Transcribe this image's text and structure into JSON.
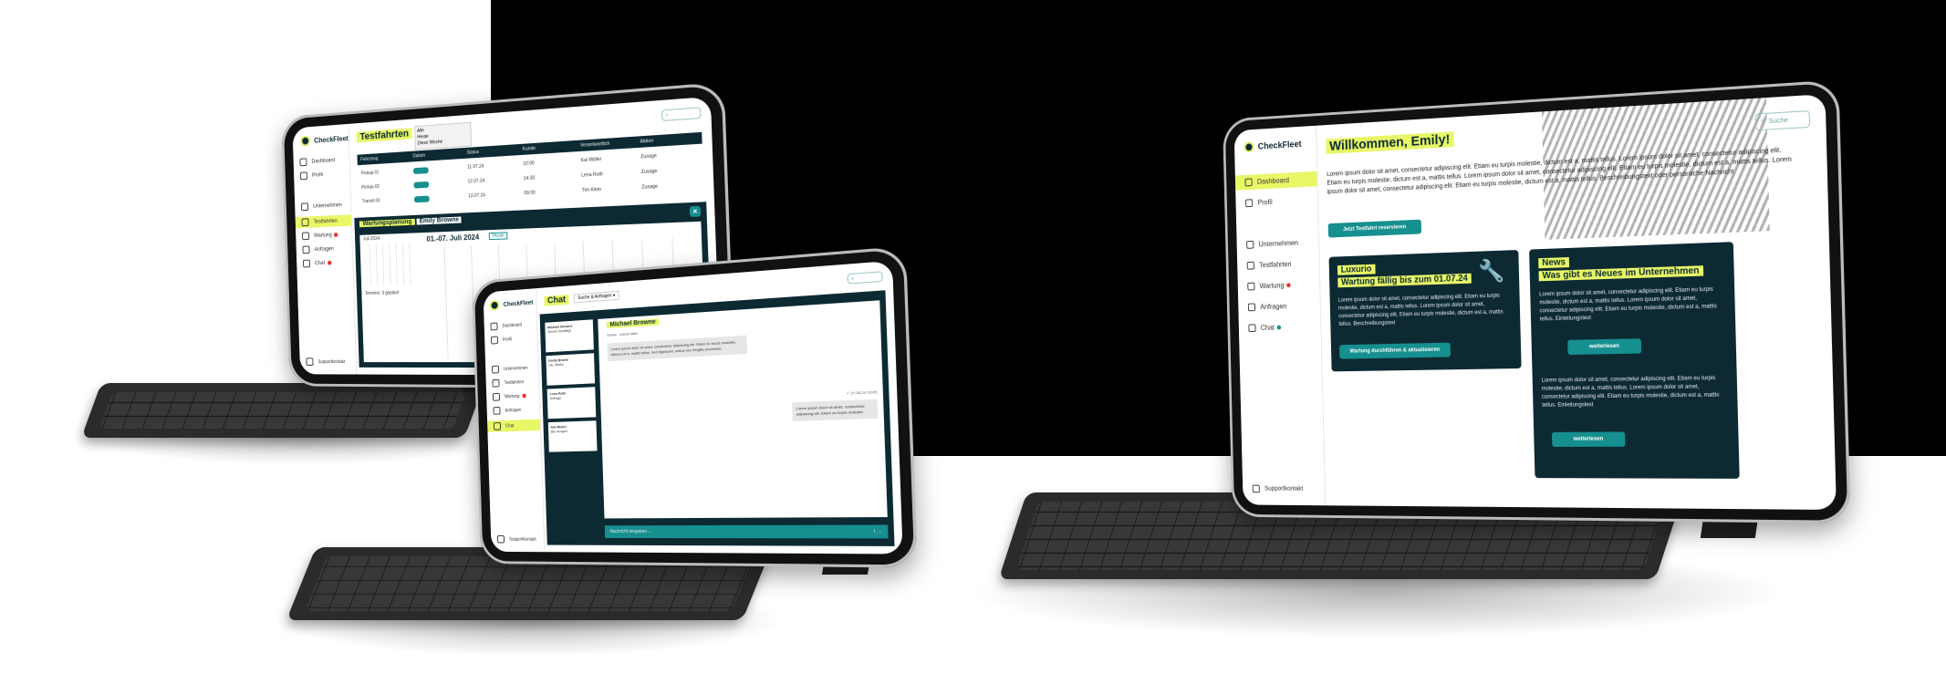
{
  "colors": {
    "accent": "#e8f766",
    "dark": "#0d2a33",
    "teal": "#168f8f",
    "red": "#e33333"
  },
  "app": {
    "brand": "CheckFleet",
    "nav": [
      "Dashboard",
      "Profil",
      "Unternehmen",
      "Testfahrten",
      "Wartung",
      "Anfragen",
      "Chat"
    ],
    "support": "Supportkontakt"
  },
  "tablet1": {
    "title": "Testfahrten",
    "dropdown_items": [
      "Alle",
      "Heute",
      "Diese Woche"
    ],
    "table_headers": [
      "Fahrzeug",
      "Datum",
      "Status",
      "Kunde",
      "Verantwortlich",
      "Aktion"
    ],
    "rows": [
      [
        "Pickup 01",
        "11.07.24",
        "10:00",
        "Kai Müller",
        "Zusage"
      ],
      [
        "Pickup 02",
        "12.07.24",
        "14:30",
        "Lena Roth",
        "Zusage"
      ],
      [
        "Transit 03",
        "13.07.24",
        "09:00",
        "Tim Klein",
        "Zusage"
      ]
    ],
    "planning_tab": "Wartungsplanung",
    "planning_name": "Emily Browne",
    "date_range": "01.-07. Juli 2024",
    "today_button": "Heute",
    "month_label": "Juli 2024",
    "legend": "Termine: 3 geplant"
  },
  "tablet2": {
    "title": "Chat",
    "filter": "Suche & Anfragen",
    "contact_name": "Michael Browne",
    "contact_sub": "Online · zuletzt aktiv",
    "conversations": [
      {
        "name": "Michael Browne",
        "preview": "Termin bestätigt"
      },
      {
        "name": "Emily Brown",
        "preview": "Ok, danke"
      },
      {
        "name": "Lena Roth",
        "preview": "Anfrage"
      },
      {
        "name": "Kai Müller",
        "preview": "Bis morgen"
      }
    ],
    "msg_in": "Lorem ipsum dolor sit amet, consectetur adipiscing elit. Etiam eu turpis molestie, dictum est a, mattis tellus. Sed dignissim, metus nec fringilla accumsan.",
    "msg_time": "27.06.24 10:05",
    "msg_out": "Lorem ipsum dolor sit amet, consectetur adipiscing elit. Etiam eu turpis molestie.",
    "input_placeholder": "Nachricht eingeben ..."
  },
  "tablet3": {
    "greeting": "Willkommen, Emily!",
    "search_placeholder": "Suche",
    "intro": "Lorem ipsum dolor sit amet, consectetur adipiscing elit. Etiam eu turpis molestie, dictum est a, mattis tellus. Lorem ipsum dolor sit amet, consectetur adipiscing elit. Etiam eu turpis molestie, dictum est a, mattis tellus. Lorem ipsum dolor sit amet, consectetur adipiscing elit. Etiam eu turpis molestie, dictum est a, mattis tellus. Lorem ipsum dolor sit amet, consectetur adipiscing elit. Etiam eu turpis molestie, dictum est a, mattis tellus. Beschreibungstext oder persönliche Nachricht",
    "cta": "Jetzt Testfahrt reservieren",
    "card1": {
      "tag": "Luxurio",
      "headline": "Wartung fällig bis zum 01.07.24",
      "body": "Lorem ipsum dolor sit amet, consectetur adipiscing elit. Etiam eu turpis molestie, dictum est a, mattis tellus. Lorem ipsum dolor sit amet, consectetur adipiscing elit. Etiam eu turpis molestie, dictum est a, mattis tellus. Beschreibungstext",
      "button": "Wartung durchführen & aktualisieren"
    },
    "card2": {
      "tag": "News",
      "headline": "Was gibt es Neues im Unternehmen",
      "body1": "Lorem ipsum dolor sit amet, consectetur adipiscing elit. Etiam eu turpis molestie, dictum est a, mattis tellus. Lorem ipsum dolor sit amet, consectetur adipiscing elit. Etiam eu turpis molestie, dictum est a, mattis tellus. Einleitungstext",
      "button1": "weiterlesen",
      "body2": "Lorem ipsum dolor sit amet, consectetur adipiscing elit. Etiam eu turpis molestie, dictum est a, mattis tellus. Lorem ipsum dolor sit amet, consectetur adipiscing elit. Etiam eu turpis molestie, dictum est a, mattis tellus. Einleitungstext",
      "button2": "weiterlesen"
    }
  }
}
